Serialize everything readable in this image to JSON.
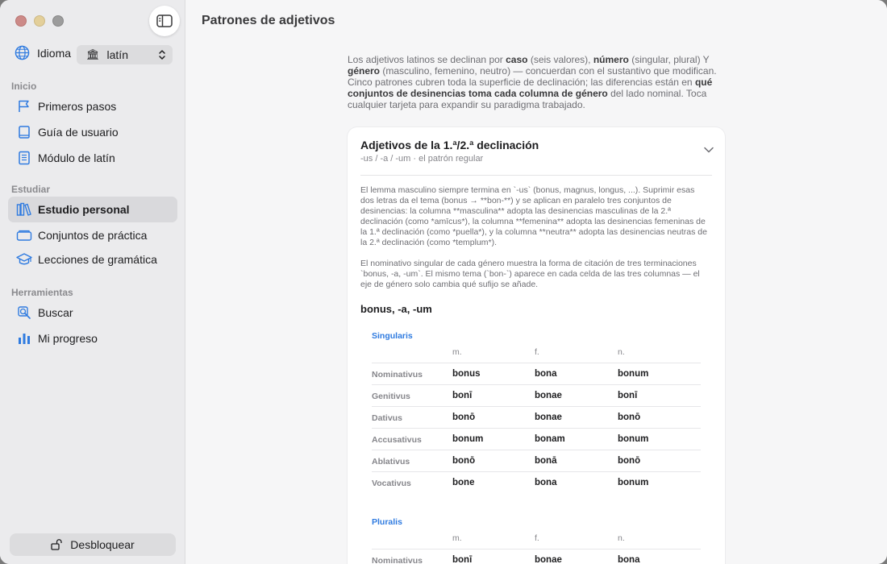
{
  "sidebar": {
    "language_label": "Idioma",
    "language_value": "latín",
    "sections": [
      {
        "title": "Inicio",
        "items": [
          {
            "label": "Primeros pasos",
            "icon": "flag-icon"
          },
          {
            "label": "Guía de usuario",
            "icon": "book-icon"
          },
          {
            "label": "Módulo de latín",
            "icon": "notebook-icon"
          }
        ]
      },
      {
        "title": "Estudiar",
        "items": [
          {
            "label": "Estudio personal",
            "icon": "books-icon",
            "active": true
          },
          {
            "label": "Conjuntos de práctica",
            "icon": "cards-icon"
          },
          {
            "label": "Lecciones de gramática",
            "icon": "graduation-cap-icon"
          }
        ]
      },
      {
        "title": "Herramientas",
        "items": [
          {
            "label": "Buscar",
            "icon": "search-icon"
          },
          {
            "label": "Mi progreso",
            "icon": "chart-icon"
          }
        ]
      }
    ],
    "unlock_label": "Desbloquear"
  },
  "main": {
    "title": "Patrones de adjetivos",
    "intro": {
      "p1": "Los adjetivos latinos se declinan por ",
      "b1": "caso",
      "p2": " (seis valores), ",
      "b2": "número",
      "p3": " (singular, plural) Y ",
      "b3": "género",
      "p4": " (masculino, femenino, neutro) — concuerdan con el sustantivo que modifican. Cinco patrones cubren toda la superficie de declinación; las diferencias están en ",
      "b4": "qué conjuntos de desinencias toma cada columna de género",
      "p5": " del lado nominal. Toca cualquier tarjeta para expandir su paradigma trabajado."
    },
    "card": {
      "title": "Adjetivos de la 1.ª/2.ª declinación",
      "subtitle": "-us / -a / -um · el patrón regular",
      "para1": "El lemma masculino siempre termina en `-us` (bonus, magnus, longus, ...). Suprimir esas dos letras da el tema (bonus → **bon-**) y se aplican en paralelo tres conjuntos de desinencias: la columna **masculina** adopta las desinencias masculinas de la 2.ª declinación (como *amīcus*), la columna **femenina** adopta las desinencias femeninas de la 1.ª declinación (como *puella*), y la columna **neutra** adopta las desinencias neutras de la 2.ª declinación (como *templum*).",
      "para2": "El nominativo singular de cada género muestra la forma de citación de tres terminaciones `bonus, -a, -um`. El mismo tema (`bon-`) aparece en cada celda de las tres columnas — el eje de género solo cambia qué sufijo se añade.",
      "lemma": "bonus, -a, -um",
      "columns": [
        "m.",
        "f.",
        "n."
      ],
      "singular": {
        "label": "Singularis",
        "rows": [
          {
            "case": "Nominativus",
            "forms": [
              "bonus",
              "bona",
              "bonum"
            ]
          },
          {
            "case": "Genitivus",
            "forms": [
              "bonī",
              "bonae",
              "bonī"
            ]
          },
          {
            "case": "Dativus",
            "forms": [
              "bonō",
              "bonae",
              "bonō"
            ]
          },
          {
            "case": "Accusativus",
            "forms": [
              "bonum",
              "bonam",
              "bonum"
            ]
          },
          {
            "case": "Ablativus",
            "forms": [
              "bonō",
              "bonā",
              "bonō"
            ]
          },
          {
            "case": "Vocativus",
            "forms": [
              "bone",
              "bona",
              "bonum"
            ]
          }
        ]
      },
      "plural": {
        "label": "Pluralis",
        "rows": [
          {
            "case": "Nominativus",
            "forms": [
              "bonī",
              "bonae",
              "bona"
            ]
          }
        ]
      }
    }
  }
}
